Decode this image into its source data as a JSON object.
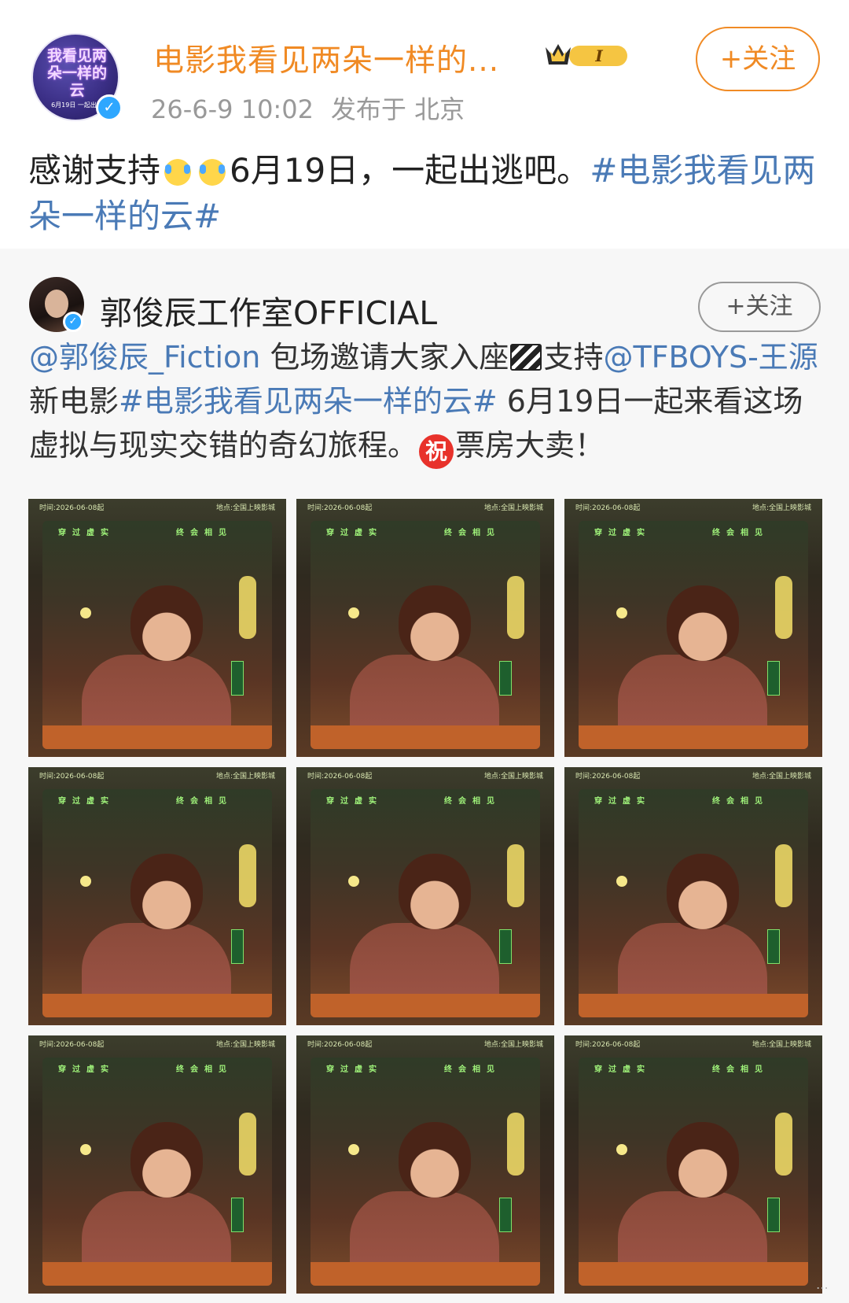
{
  "post": {
    "author": "电影我看见两朵一样的...",
    "avatar_logo_text": "我看见两朵一样的云",
    "avatar_logo_date": "6月19日 一起出逃",
    "level_badge": "I",
    "follow_label": "+关注",
    "time": "26-6-9 10:02",
    "location": "发布于 北京",
    "text_before": "感谢支持",
    "text_after": "6月19日，一起出逃吧。",
    "hashtag": "#电影我看见两朵一样的云#"
  },
  "repost": {
    "author": "郭俊辰工作室OFFICIAL",
    "follow_label": "+关注",
    "mention1": "@郭俊辰_Fiction",
    "text1": " 包场邀请大家入座",
    "text2": "支持",
    "mention2": "@TFBOYS-王源",
    "text3": " 新电影",
    "hashtag": "#电影我看见两朵一样的云#",
    "text4": " 6月19日一起来看这场虚拟与现实交错的奇幻旅程。",
    "zhu_badge": "祝",
    "text5": "票房大卖！",
    "image_caption_left": "时间:2026-06-08起",
    "image_caption_right": "地点:全国上映影城",
    "image_slogan_left": "穿过虚实",
    "image_slogan_right": "终会相见",
    "image_count": 9
  },
  "icons": {
    "verified": "verified-icon",
    "crown": "crown-icon",
    "clapperboard": "clapperboard-icon"
  },
  "colors": {
    "accent": "#f08a24",
    "link": "#4a7ab6",
    "verified": "#2ea7ff",
    "repost_bg": "#f7f7f7"
  }
}
